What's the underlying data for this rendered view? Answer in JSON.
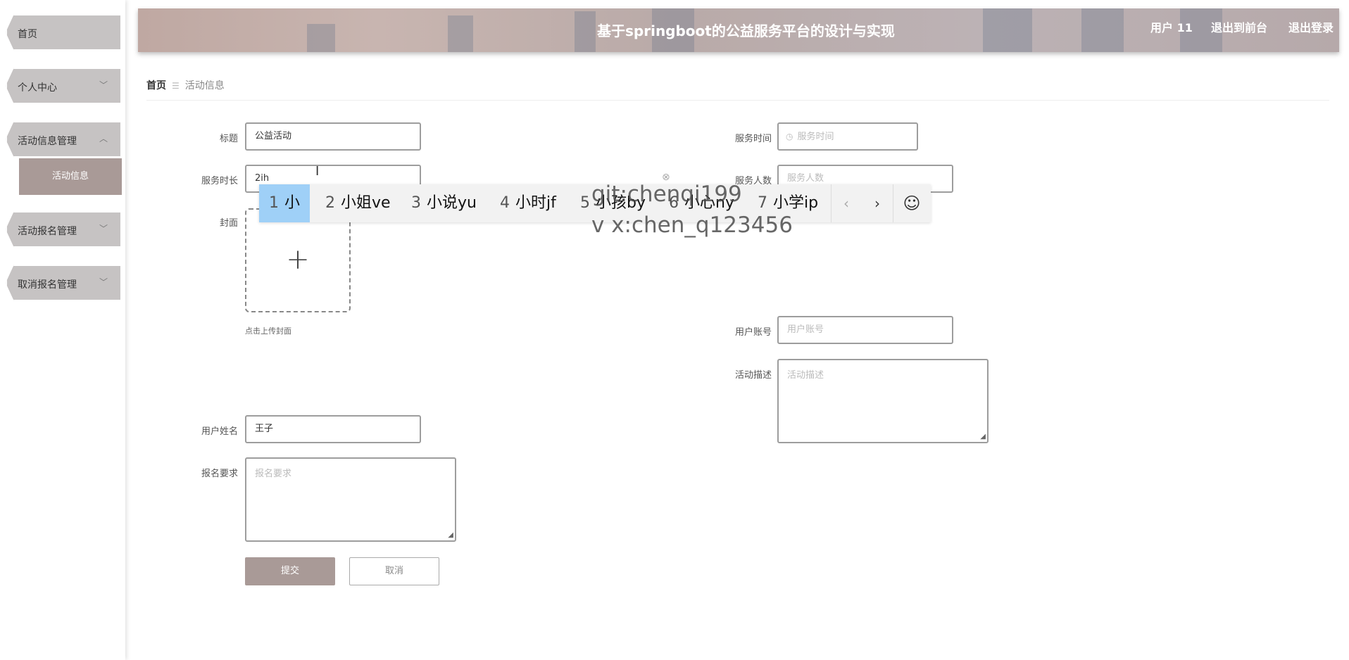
{
  "sidebar": {
    "items": [
      {
        "label": "首页"
      },
      {
        "label": "个人中心",
        "chevron": "chevron-down-icon"
      },
      {
        "label": "活动信息管理",
        "chevron": "chevron-up-icon"
      },
      {
        "label": "活动报名管理",
        "chevron": "chevron-down-icon"
      },
      {
        "label": "取消报名管理",
        "chevron": "chevron-down-icon"
      }
    ],
    "sub_item": "活动信息"
  },
  "header": {
    "title": "基于springboot的公益服务平台的设计与实现",
    "user": "用户 11",
    "back_front": "退出到前台",
    "logout": "退出登录"
  },
  "breadcrumb": {
    "home": "首页",
    "current": "活动信息"
  },
  "form": {
    "title": {
      "label": "标题",
      "value": "公益活动"
    },
    "service_time": {
      "label": "服务时间",
      "placeholder": "服务时间"
    },
    "service_hours": {
      "label": "服务时长",
      "value": "2ih"
    },
    "service_count": {
      "label": "服务人数",
      "placeholder": "服务人数"
    },
    "cover": {
      "label": "封面",
      "tip": "点击上传封面"
    },
    "user_account": {
      "label": "用户账号",
      "placeholder": "用户账号"
    },
    "activity_desc": {
      "label": "活动描述",
      "placeholder": "活动描述"
    },
    "user_name": {
      "label": "用户姓名",
      "value": "王子"
    },
    "signup_req": {
      "label": "报名要求",
      "placeholder": "报名要求"
    },
    "submit": "提交",
    "cancel": "取消"
  },
  "ime": {
    "candidates": [
      {
        "num": "1",
        "text": "小"
      },
      {
        "num": "2",
        "text": "小姐ve"
      },
      {
        "num": "3",
        "text": "小说yu"
      },
      {
        "num": "4",
        "text": "小时jf"
      },
      {
        "num": "5",
        "text": "小孩by"
      },
      {
        "num": "6",
        "text": "小心ny"
      },
      {
        "num": "7",
        "text": "小学ip"
      }
    ],
    "prev": "‹",
    "next": "›",
    "emoji": "☺"
  },
  "watermark": {
    "line1": "git:chenqi199",
    "line2": "v x:chen_q123456"
  },
  "colors": {
    "accent": "#a99a97",
    "menu_bg": "#c6c3c3",
    "ime_selected": "#9fd0f7"
  }
}
